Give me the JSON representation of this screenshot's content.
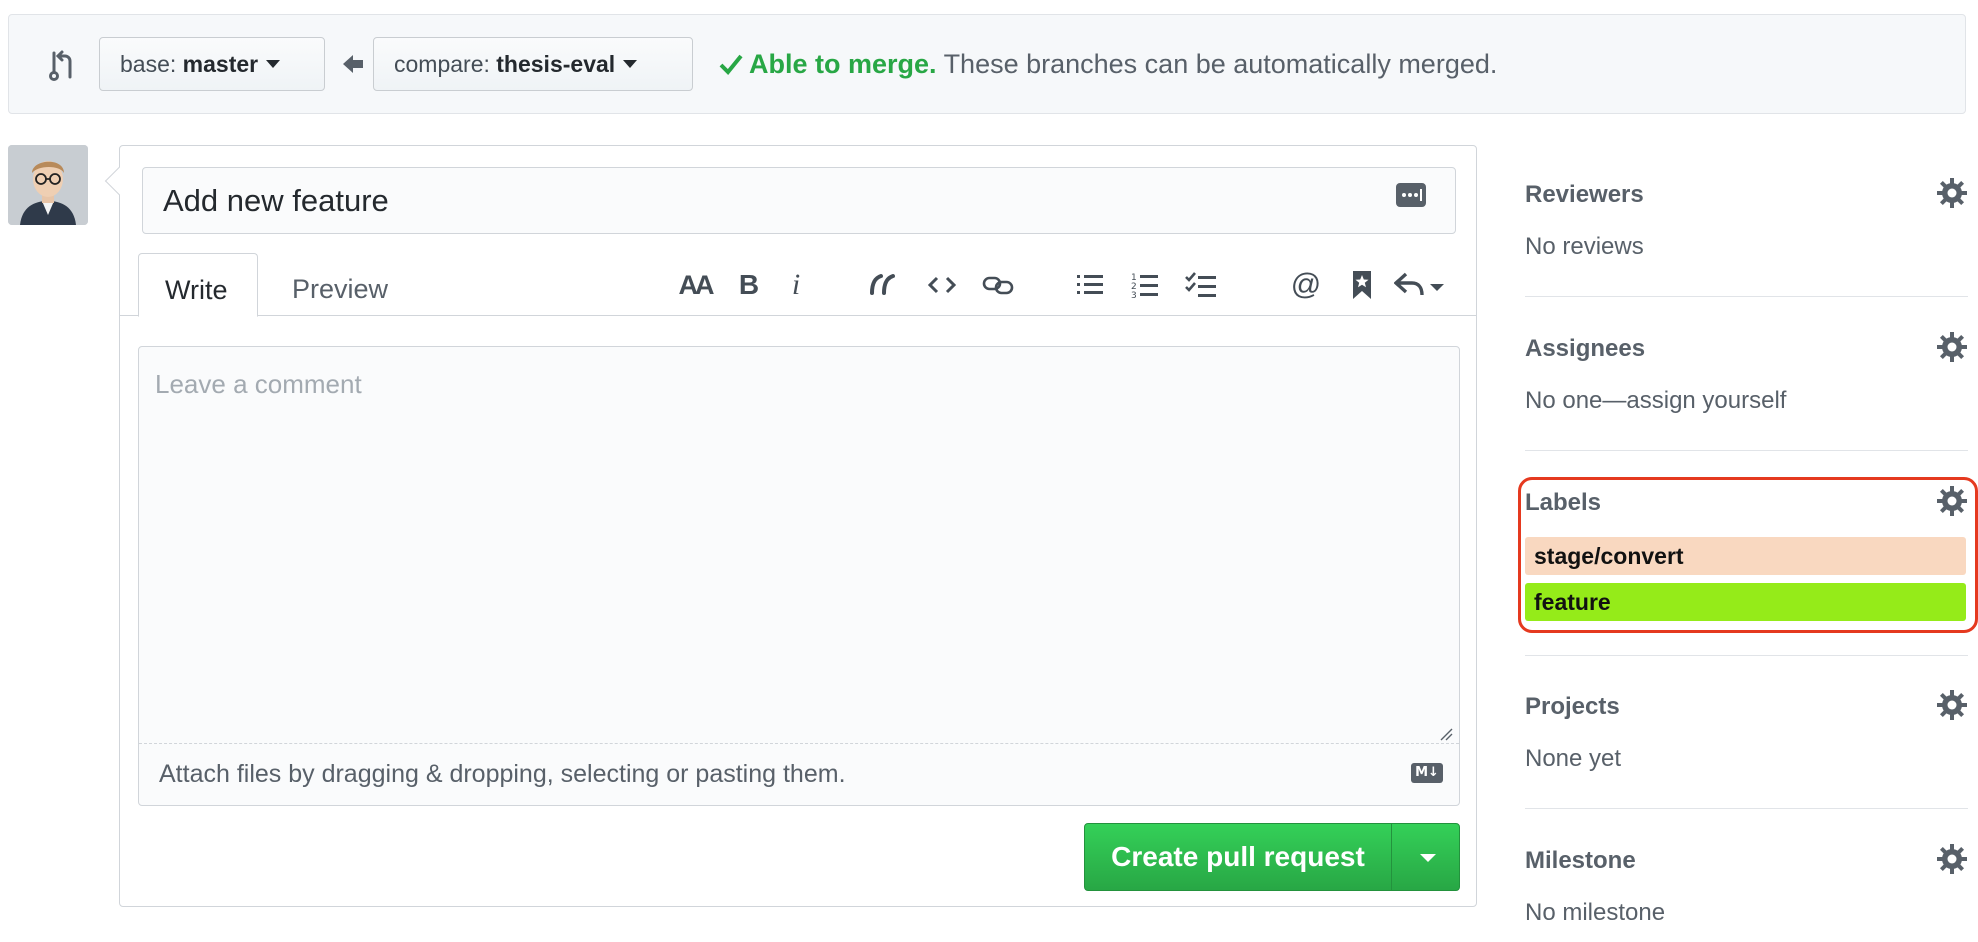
{
  "compare_bar": {
    "base_prefix": "base:",
    "base_branch": "master",
    "compare_prefix": "compare:",
    "compare_branch": "thesis-eval",
    "merge_ok": "Able to merge.",
    "merge_desc": "These branches can be automatically merged."
  },
  "form": {
    "title_value": "Add new feature",
    "tabs": {
      "write": "Write",
      "preview": "Preview"
    },
    "comment_placeholder": "Leave a comment",
    "attach_text": "Attach files by dragging & dropping, selecting or pasting them.",
    "markdown_badge": "M↓",
    "submit_label": "Create pull request"
  },
  "toolbar": {
    "items": [
      "header-icon",
      "bold-icon",
      "italic-icon",
      "quote-icon",
      "code-icon",
      "link-icon",
      "bulleted-list-icon",
      "numbered-list-icon",
      "task-list-icon",
      "mention-icon",
      "reference-icon",
      "reply-icon"
    ],
    "bold_glyph": "B",
    "italic_glyph": "i",
    "header_glyph": "AA",
    "mention_glyph": "@"
  },
  "sidebar": {
    "reviewers": {
      "title": "Reviewers",
      "value": "No reviews"
    },
    "assignees": {
      "title": "Assignees",
      "value": "No one—assign yourself"
    },
    "labels": {
      "title": "Labels",
      "items": [
        {
          "name": "stage/convert",
          "color": "#f9d8c0"
        },
        {
          "name": "feature",
          "color": "#95eb19"
        }
      ]
    },
    "projects": {
      "title": "Projects",
      "value": "None yet"
    },
    "milestone": {
      "title": "Milestone",
      "value": "No milestone"
    }
  },
  "colors": {
    "merge_green": "#28a745",
    "highlight_red": "#e5391f"
  }
}
